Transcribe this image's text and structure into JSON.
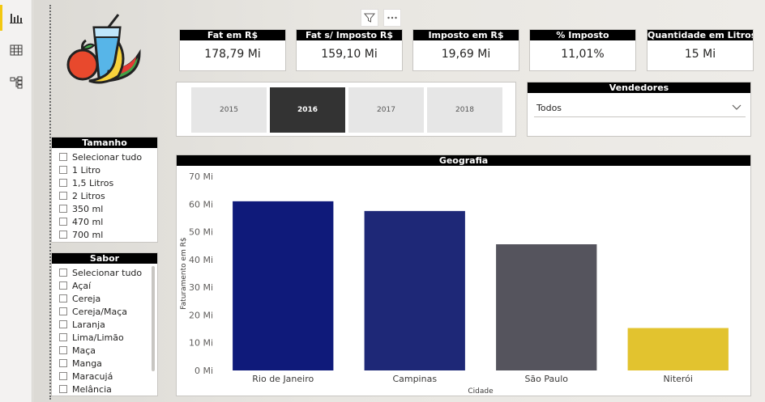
{
  "sidebar": {
    "items": [
      {
        "icon": "report-view-icon",
        "active": true
      },
      {
        "icon": "data-view-icon",
        "active": false
      },
      {
        "icon": "model-view-icon",
        "active": false
      }
    ]
  },
  "visual_header": {
    "icons": [
      "filter-icon",
      "more-options-icon"
    ]
  },
  "logo": {
    "icon": "juice-fruits-logo"
  },
  "kpis": [
    {
      "title": "Fat em R$",
      "value": "178,79 Mi"
    },
    {
      "title": "Fat s/ Imposto R$",
      "value": "159,10 Mi"
    },
    {
      "title": "Imposto em R$",
      "value": "19,69 Mi"
    },
    {
      "title": "% Imposto",
      "value": "11,01%"
    },
    {
      "title": "Quantidade em Litros",
      "value": "15 Mi"
    }
  ],
  "years": {
    "options": [
      "2015",
      "2016",
      "2017",
      "2018"
    ],
    "selected": "2016"
  },
  "vendedores": {
    "title": "Vendedores",
    "value": "Todos"
  },
  "tamanho": {
    "title": "Tamanho",
    "items": [
      "Selecionar tudo",
      "1 Litro",
      "1,5 Litros",
      "2 Litros",
      "350 ml",
      "470 ml",
      "700 ml"
    ]
  },
  "sabor": {
    "title": "Sabor",
    "items": [
      "Selecionar tudo",
      "Açaí",
      "Cereja",
      "Cereja/Maça",
      "Laranja",
      "Lima/Limão",
      "Maça",
      "Manga",
      "Maracujá",
      "Melância"
    ]
  },
  "chart_data": {
    "type": "bar",
    "title": "Geografia",
    "xlabel": "Cidade",
    "ylabel": "Faturamento em R$",
    "categories": [
      "Rio de Janeiro",
      "Campinas",
      "São Paulo",
      "Niterói"
    ],
    "values": [
      61,
      57.5,
      45.5,
      15.3
    ],
    "colors": [
      "#0f1a7a",
      "#1e2877",
      "#55545d",
      "#e2c32f"
    ],
    "ylim": [
      0,
      70
    ],
    "yticks": [
      {
        "v": 0,
        "label": "0 Mi"
      },
      {
        "v": 10,
        "label": "10 Mi"
      },
      {
        "v": 20,
        "label": "20 Mi"
      },
      {
        "v": 30,
        "label": "30 Mi"
      },
      {
        "v": 40,
        "label": "40 Mi"
      },
      {
        "v": 50,
        "label": "50 Mi"
      },
      {
        "v": 60,
        "label": "60 Mi"
      },
      {
        "v": 70,
        "label": "70 Mi"
      }
    ],
    "grid": false
  }
}
